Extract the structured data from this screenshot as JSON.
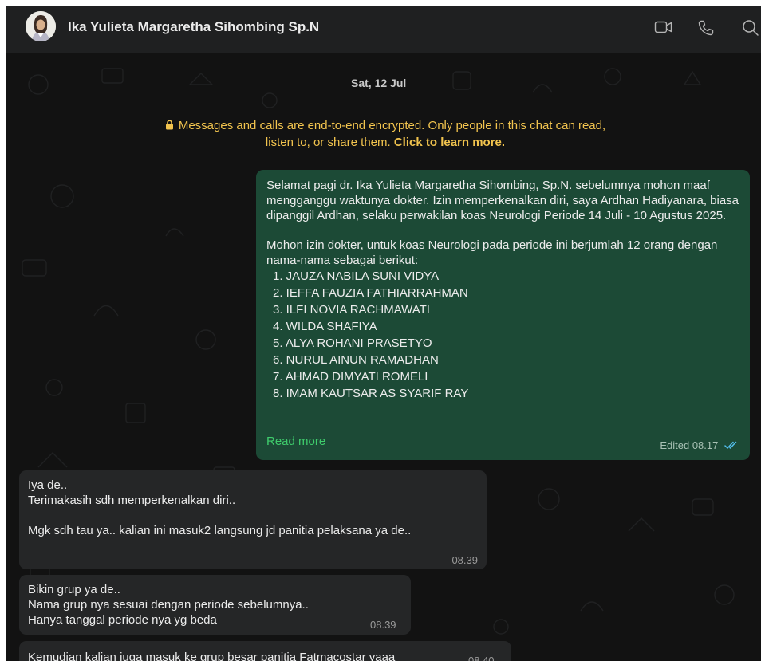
{
  "header": {
    "contact_name": "Ika Yulieta Margaretha Sihombing Sp.N",
    "icons": [
      "video-call-icon",
      "voice-call-icon",
      "search-icon"
    ]
  },
  "chat": {
    "date": "Sat, 12 Jul",
    "encryption_notice": {
      "text": "Messages and calls are end-to-end encrypted. Only people in this chat can read, listen to, or share them.",
      "link": "Click to learn more."
    },
    "outgoing": {
      "paragraph1": "Selamat pagi dr. Ika Yulieta Margaretha Sihombing, Sp.N. sebelumnya mohon maaf mengganggu waktunya dokter. Izin memperkenalkan diri, saya Ardhan Hadiyanara, biasa dipanggil Ardhan, selaku perwakilan koas Neurologi Periode 14 Juli - 10 Agustus  2025.",
      "paragraph2": "Mohon izin dokter, untuk koas Neurologi pada periode ini berjumlah 12 orang dengan nama-nama sebagai berikut:",
      "names": [
        "1. JAUZA NABILA SUNI VIDYA",
        "2. IEFFA FAUZIA FATHIARRAHMAN",
        "3. ILFI NOVIA RACHMAWATI",
        "4. WILDA SHAFIYA",
        "5. ALYA ROHANI PRASETYO",
        "6. NURUL AINUN RAMADHAN",
        "7. AHMAD DIMYATI ROMELI",
        "8. IMAM KAUTSAR AS SYARIF RAY"
      ],
      "read_more": "Read more",
      "edited_label": "Edited",
      "time": "08.17",
      "status": "read"
    },
    "incoming": [
      {
        "lines": [
          "Iya de..",
          "Terimakasih sdh memperkenalkan diri..",
          "",
          "Mgk sdh tau ya.. kalian ini masuk2 langsung jd panitia pelaksana ya de.."
        ],
        "time": "08.39"
      },
      {
        "lines": [
          "Bikin grup ya de..",
          "Nama grup nya sesuai dengan periode sebelumnya..",
          "Hanya tanggal periode nya yg beda"
        ],
        "time": "08.39"
      },
      {
        "lines": [
          "Kemudian kalian juga masuk ke grup besar panitia Fatmacostar yaaa"
        ],
        "time": "08.40"
      }
    ]
  },
  "colors": {
    "header_bg": "#1f2021",
    "chat_bg": "#121212",
    "outgoing_bubble": "#1c4a36",
    "incoming_bubble": "#252627",
    "encryption_text": "#f2c44e",
    "read_more": "#3fcc6c",
    "read_ticks": "#53bdeb"
  }
}
